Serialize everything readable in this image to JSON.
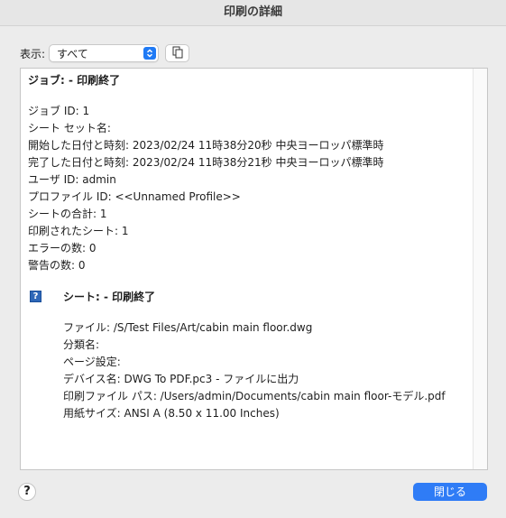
{
  "window": {
    "title": "印刷の詳細"
  },
  "toolbar": {
    "view_label": "表示:",
    "view_value": "すべて"
  },
  "job": {
    "header": "ジョブ: - 印刷終了",
    "lines": [
      "ジョブ ID: 1",
      "シート セット名:",
      "開始した日付と時刻: 2023/02/24 11時38分20秒 中央ヨーロッパ標準時",
      "完了した日付と時刻: 2023/02/24 11時38分21秒 中央ヨーロッパ標準時",
      "ユーザ ID: admin",
      "プロファイル ID: <<Unnamed Profile>>",
      "シートの合計: 1",
      "印刷されたシート: 1",
      "エラーの数: 0",
      "警告の数: 0"
    ]
  },
  "sheet": {
    "icon": "question-icon",
    "icon_glyph": "?",
    "header": "シート: - 印刷終了",
    "lines": [
      "ファイル: /S/Test Files/Art/cabin main floor.dwg",
      "分類名:",
      "ページ設定:",
      "デバイス名: DWG To PDF.pc3 - ファイルに出力",
      "印刷ファイル パス: /Users/admin/Documents/cabin main floor-モデル.pdf",
      "用紙サイズ: ANSI A (8.50 x 11.00 Inches)"
    ]
  },
  "footer": {
    "help_glyph": "?",
    "close_label": "閉じる"
  },
  "colors": {
    "accent": "#2f7cf6",
    "window_bg": "#ececec"
  }
}
